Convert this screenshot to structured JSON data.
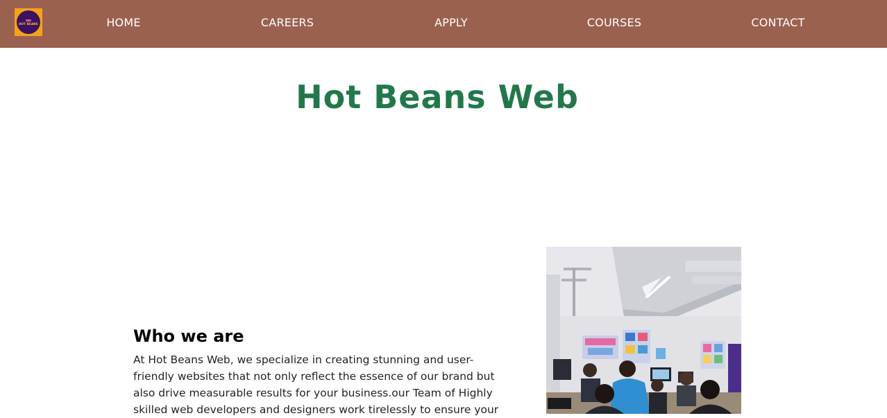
{
  "nav": {
    "logo": {
      "label": "HOT BEANS",
      "icon": "hot-beans-logo-icon"
    },
    "links": [
      "HOME",
      "CAREERS",
      "APPLY",
      "COURSES",
      "CONTACT"
    ]
  },
  "hero": {
    "title": "Hot Beans Web"
  },
  "about": {
    "heading": "Who we are",
    "text": "At Hot Beans Web, we specialize in creating stunning and user-friendly websites that not only reflect the essence of our brand but also drive measurable results for your business.our Team of Highly skilled web developers and designers work tirelessly to ensure your"
  },
  "photo": {
    "icon": "classroom-photo"
  },
  "colors": {
    "navbar": "#9b614f",
    "title": "#23784a",
    "logo_bg": "#f5a11c",
    "logo_inner": "#3a1260"
  }
}
